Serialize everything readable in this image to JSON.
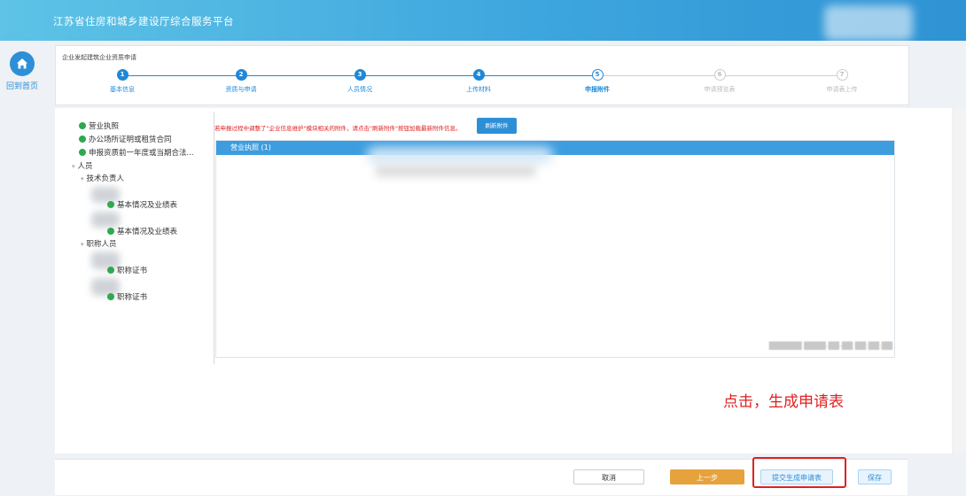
{
  "header": {
    "title": "江苏省住房和城乡建设厅综合服务平台"
  },
  "home": {
    "label": "回到首页",
    "icon": "home-icon"
  },
  "breadcrumb": "企业发起建筑企业资质申请",
  "steps": [
    {
      "num": "1",
      "label": "基本信息",
      "state": "done"
    },
    {
      "num": "2",
      "label": "资质与申请",
      "state": "done"
    },
    {
      "num": "3",
      "label": "人员情况",
      "state": "done"
    },
    {
      "num": "4",
      "label": "上传材料",
      "state": "done"
    },
    {
      "num": "5",
      "label": "申报附件",
      "state": "current"
    },
    {
      "num": "6",
      "label": "申请预览表",
      "state": "todo"
    },
    {
      "num": "7",
      "label": "申请表上传",
      "state": "todo"
    }
  ],
  "tree": {
    "items": [
      {
        "label": "营业执照",
        "status": "ok"
      },
      {
        "label": "办公场所证明或租赁合同",
        "status": "ok"
      },
      {
        "label": "申报资质前一年度或当期合法...",
        "status": "ok"
      }
    ],
    "personnel": {
      "label": "人员",
      "tech_lead": {
        "label": "技术负责人",
        "children": [
          "基本情况及业绩表",
          "基本情况及业绩表"
        ]
      },
      "titled": {
        "label": "职称人员",
        "children": [
          "职称证书",
          "职称证书"
        ]
      }
    }
  },
  "notice": "若申报过程中调整了\"企业信息维护\"模块相关的附件，请点击\"刷新附件\"按钮加载最新附件信息。",
  "refresh_button": "刷新附件",
  "panel": {
    "title": "营业执照  (1)"
  },
  "annotation": "点击，生成申请表",
  "buttons": {
    "cancel": "取消",
    "prev": "上一步",
    "submit": "提交生成申请表",
    "save": "保存"
  },
  "colors": {
    "primary": "#2d8fd6",
    "warning": "#e6a23c",
    "success": "#2fa84f",
    "alert": "#e02020"
  }
}
